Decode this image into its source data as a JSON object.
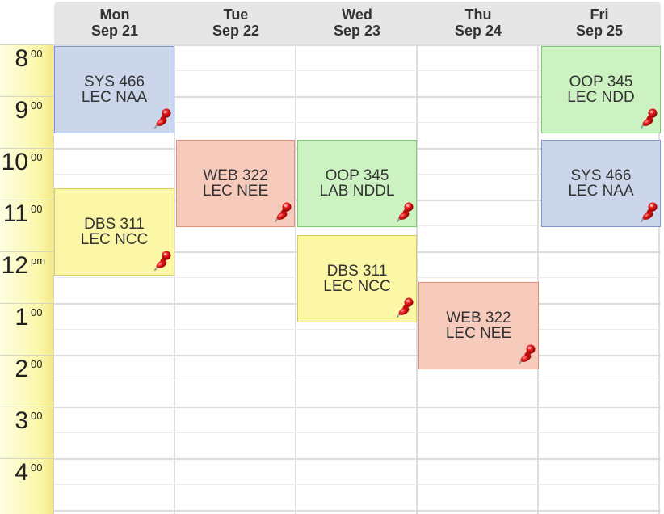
{
  "days": [
    {
      "dow": "Mon",
      "date": "Sep 21"
    },
    {
      "dow": "Tue",
      "date": "Sep 22"
    },
    {
      "dow": "Wed",
      "date": "Sep 23"
    },
    {
      "dow": "Thu",
      "date": "Sep 24"
    },
    {
      "dow": "Fri",
      "date": "Sep 25"
    }
  ],
  "hours": [
    {
      "num": "8",
      "suffix": "00"
    },
    {
      "num": "9",
      "suffix": "00"
    },
    {
      "num": "10",
      "suffix": "00"
    },
    {
      "num": "11",
      "suffix": "00"
    },
    {
      "num": "12",
      "suffix": "pm"
    },
    {
      "num": "1",
      "suffix": "00"
    },
    {
      "num": "2",
      "suffix": "00"
    },
    {
      "num": "3",
      "suffix": "00"
    },
    {
      "num": "4",
      "suffix": "00"
    }
  ],
  "events": [
    {
      "line1": "SYS 466",
      "line2": "LEC NAA",
      "day": "Mon",
      "start": "8:00",
      "end": "9:45",
      "color": "#ccd6ea",
      "border": "#7f96cc"
    },
    {
      "line1": "DBS 311",
      "line2": "LEC NCC",
      "day": "Mon",
      "start": "10:45",
      "end": "12:30",
      "color": "#fbf7a7",
      "border": "#d6cd62"
    },
    {
      "line1": "WEB 322",
      "line2": "LEC NEE",
      "day": "Tue",
      "start": "9:50",
      "end": "11:35",
      "color": "#f7cbbc",
      "border": "#e28f77"
    },
    {
      "line1": "OOP 345",
      "line2": "LAB NDDL",
      "day": "Wed",
      "start": "9:50",
      "end": "11:35",
      "color": "#ccf2c2",
      "border": "#7fcc74"
    },
    {
      "line1": "DBS 311",
      "line2": "LEC NCC",
      "day": "Wed",
      "start": "11:40",
      "end": "1:25",
      "color": "#fbf7a7",
      "border": "#d6cd62"
    },
    {
      "line1": "WEB 322",
      "line2": "LEC NEE",
      "day": "Thu",
      "start": "12:40",
      "end": "2:25",
      "color": "#f7cbbc",
      "border": "#e28f77"
    },
    {
      "line1": "OOP 345",
      "line2": "LEC NDD",
      "day": "Fri",
      "start": "8:00",
      "end": "9:45",
      "color": "#ccf2c2",
      "border": "#7fcc74"
    },
    {
      "line1": "SYS 466",
      "line2": "LEC NAA",
      "day": "Fri",
      "start": "9:50",
      "end": "11:35",
      "color": "#ccd6ea",
      "border": "#7f96cc"
    }
  ]
}
